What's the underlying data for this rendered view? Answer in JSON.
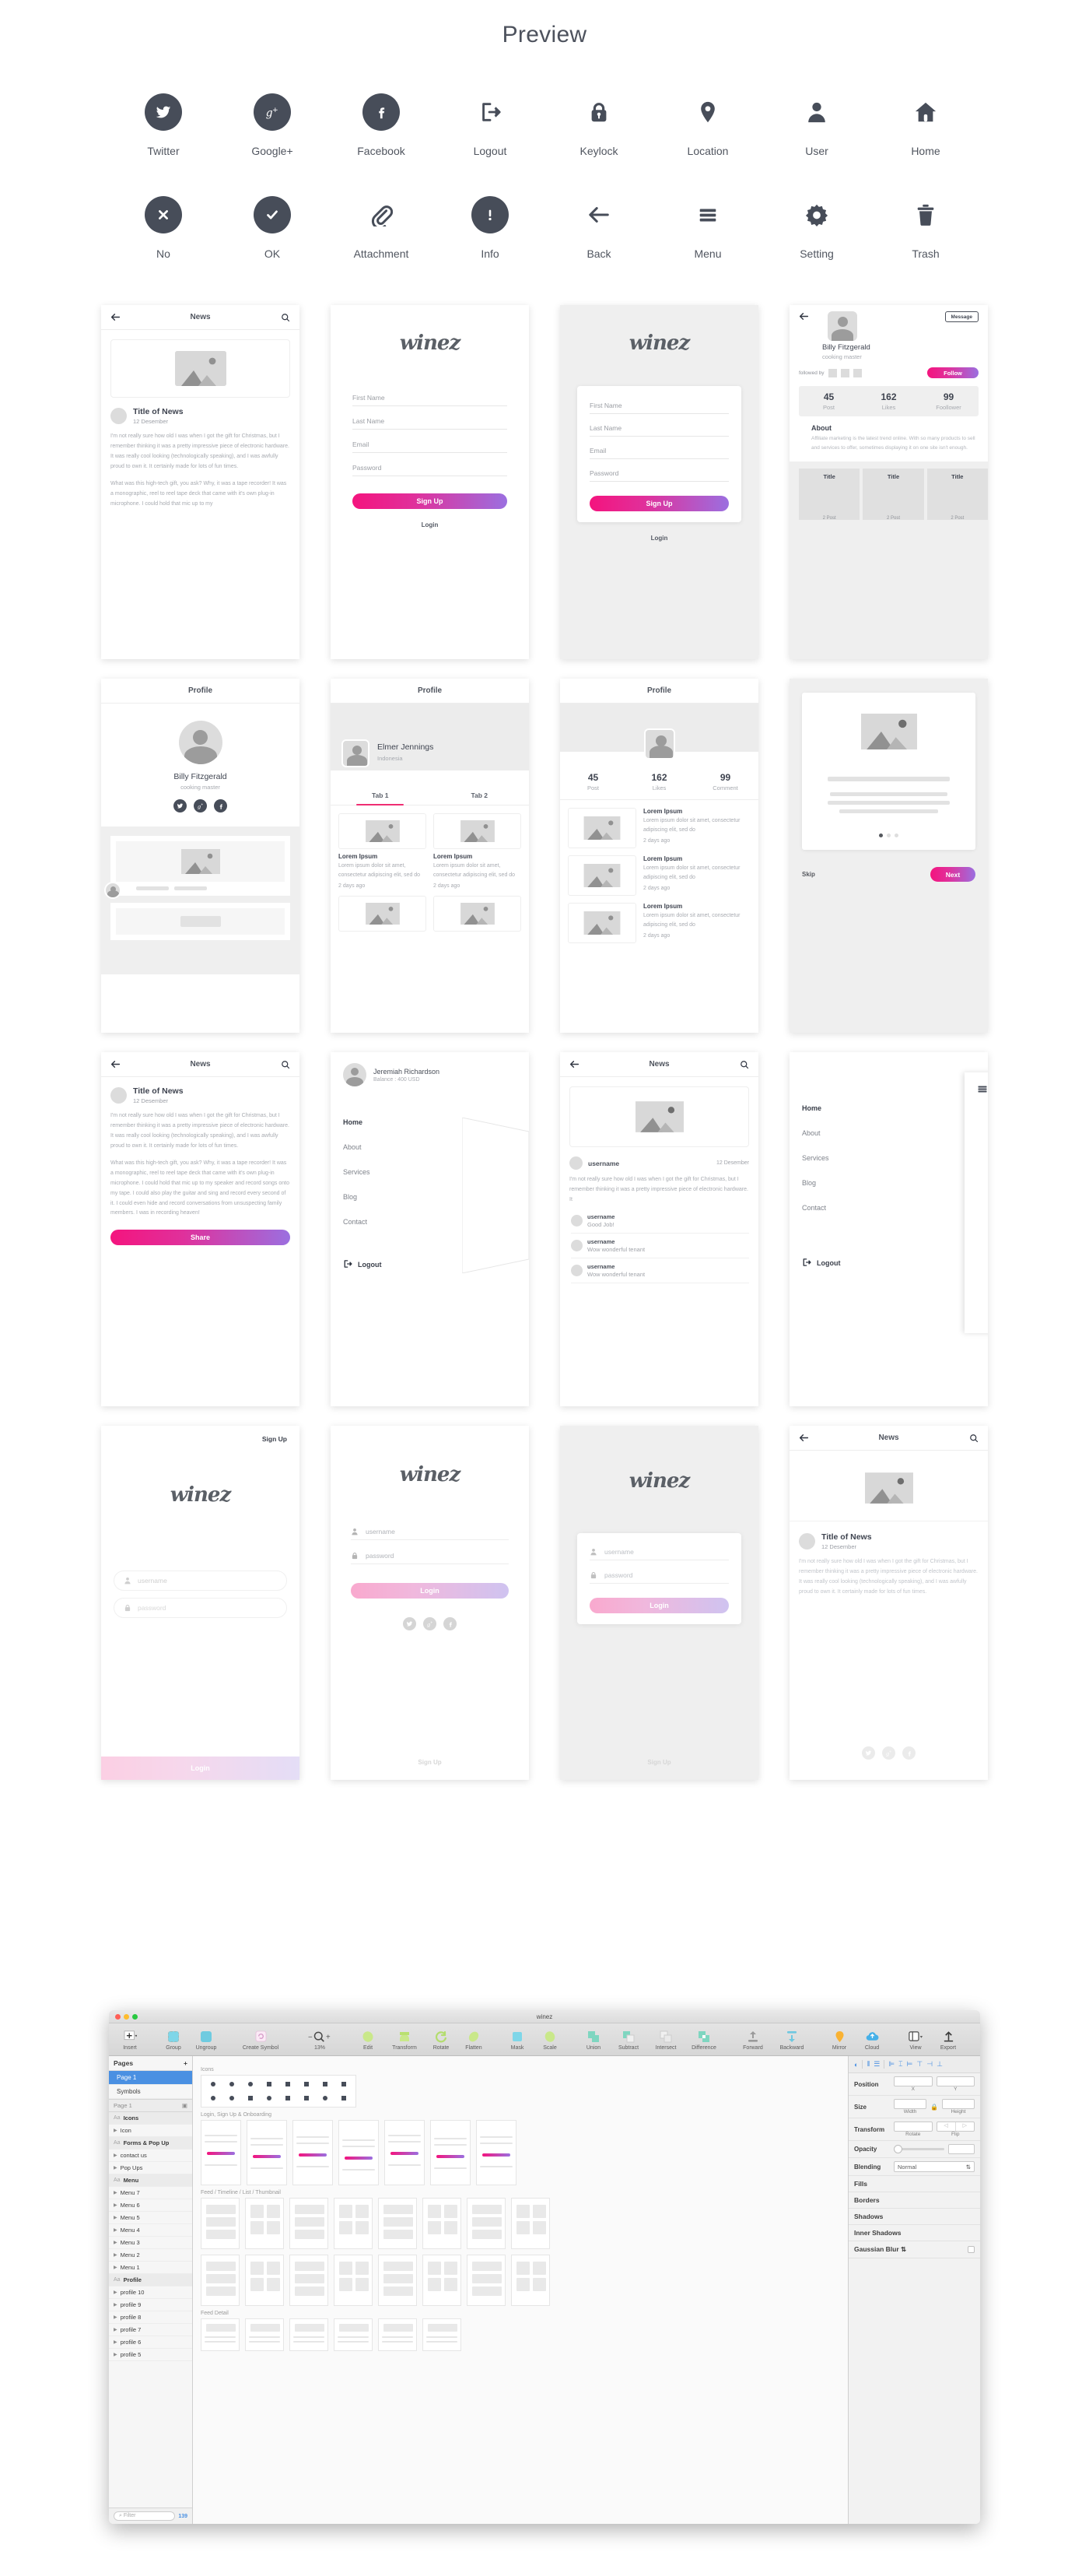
{
  "page": {
    "title": "Preview"
  },
  "icons": [
    {
      "label": "Twitter",
      "icon": "twitter-icon"
    },
    {
      "label": "Google+",
      "icon": "google-plus-icon"
    },
    {
      "label": "Facebook",
      "icon": "facebook-icon"
    },
    {
      "label": "Logout",
      "icon": "logout-icon"
    },
    {
      "label": "Keylock",
      "icon": "lock-icon"
    },
    {
      "label": "Location",
      "icon": "location-pin-icon"
    },
    {
      "label": "User",
      "icon": "user-icon"
    },
    {
      "label": "Home",
      "icon": "home-icon"
    },
    {
      "label": "No",
      "icon": "close-x-icon"
    },
    {
      "label": "OK",
      "icon": "check-icon"
    },
    {
      "label": "Attachment",
      "icon": "paperclip-icon"
    },
    {
      "label": "Info",
      "icon": "info-icon"
    },
    {
      "label": "Back",
      "icon": "arrow-left-icon"
    },
    {
      "label": "Menu",
      "icon": "hamburger-icon"
    },
    {
      "label": "Setting",
      "icon": "gear-icon"
    },
    {
      "label": "Trash",
      "icon": "trash-icon"
    }
  ],
  "brand": {
    "logo": "winez",
    "accent_from": "#f4147e",
    "accent_to": "#9b6fe0",
    "tab_accent": "#ef2d72"
  },
  "screens": {
    "news": {
      "topbar_title": "News",
      "title": "Title of News",
      "date": "12 Desember",
      "para1": "I'm not really sure how old I was when I got the gift for Christmas, but I remember thinking it was a pretty impressive piece of electronic hardware. It was really cool looking (technologically speaking), and I was awfully proud to own it. It certainly made for lots of fun times.",
      "para2": "What was this high-tech gift, you ask? Why, it was a tape recorder! It was a monographic, reel to reel tape deck that came with it's own plug-in microphone. I could hold that mic up to my",
      "para3": "What was this high-tech gift, you ask? Why, it was a tape recorder! It was a monographic, reel to reel tape deck that came with it's own plug-in microphone. I could hold that mic up to my speaker and record songs onto my tape. I could also play the guitar and sing and record every second of it. I could even hide and record conversations from unsuspecting family members. I was in recording heaven!",
      "share_button": "Share"
    },
    "signup": {
      "fields": [
        "First Name",
        "Last Name",
        "Email",
        "Password"
      ],
      "button": "Sign Up",
      "link": "Login"
    },
    "profile_card": {
      "message_button": "Message",
      "name": "Billy Fitzgerald",
      "role": "cooking master",
      "followed_by": "followed by",
      "follow_button": "Follow",
      "stats": [
        {
          "value": "45",
          "label": "Post"
        },
        {
          "value": "162",
          "label": "Likes"
        },
        {
          "value": "99",
          "label": "Foollower"
        }
      ],
      "about_heading": "About",
      "about_body": "Affiliate marketing is the latest trend online. With so many products to sell and services to offer, sometimes displaying it on one site isn't enough.",
      "cards": [
        {
          "title": "Title",
          "sub": "2 Post"
        },
        {
          "title": "Title",
          "sub": "2 Post"
        },
        {
          "title": "Title",
          "sub": "2 Post"
        }
      ]
    },
    "profile_social": {
      "topbar_title": "Profile",
      "name": "Billy Fitzgerald",
      "role": "cooking master",
      "socials": [
        "twitter-icon",
        "google-plus-icon",
        "facebook-icon"
      ]
    },
    "profile_tabs": {
      "topbar_title": "Profile",
      "name": "Elmer Jennings",
      "location": "Indonesia",
      "tabs": [
        "Tab 1",
        "Tab 2"
      ],
      "active_tab": 0,
      "items": [
        {
          "title": "Lorem Ipsum",
          "body": "Lorem ipsum dolor sit amet, consectetur adipiscing elit, sed do",
          "date": "2 days ago"
        },
        {
          "title": "Lorem Ipsum",
          "body": "Lorem ipsum dolor sit amet, consectetur adipiscing elit, sed do",
          "date": "2 days ago"
        }
      ]
    },
    "profile_stats": {
      "topbar_title": "Profile",
      "stats": [
        {
          "value": "45",
          "label": "Post"
        },
        {
          "value": "162",
          "label": "Likes"
        },
        {
          "value": "99",
          "label": "Comment"
        }
      ],
      "items": [
        {
          "title": "Lorem Ipsum",
          "body": "Lorem ipsum dolor sit amet, consectetur adipiscing elit, sed do",
          "date": "2 days ago"
        },
        {
          "title": "Lorem Ipsum",
          "body": "Lorem ipsum dolor sit amet, consectetur adipiscing elit, sed do",
          "date": "2 days ago"
        },
        {
          "title": "Lorem Ipsum",
          "body": "Lorem ipsum dolor sit amet, consectetur adipiscing elit, sed do",
          "date": "2 days ago"
        }
      ]
    },
    "onboarding": {
      "skip": "Skip",
      "next": "Next",
      "dots": 3,
      "active_dot": 0
    },
    "drawer": {
      "name": "Jeremiah Richardson",
      "balance": "Balance : 400 USD",
      "items": [
        "Home",
        "About",
        "Services",
        "Blog",
        "Contact"
      ],
      "active": "Home",
      "logout": "Logout"
    },
    "comments": {
      "topbar_title": "News",
      "author": "username",
      "date": "12 Desember",
      "post": "I'm not really sure how old I was when I got the gift for Christmas, but I remember thinking it was a pretty impressive piece of electronic hardware. It",
      "list": [
        {
          "user": "username",
          "text": "Good Job!"
        },
        {
          "user": "username",
          "text": "Wow wonderful tenant"
        },
        {
          "user": "username",
          "text": "Wow wonderful tenant"
        }
      ]
    },
    "menu_overlay": {
      "items": [
        "Home",
        "About",
        "Services",
        "Blog",
        "Contact"
      ],
      "active": "Home",
      "logout": "Logout"
    },
    "login_plain": {
      "signup_link": "Sign Up",
      "username": "username",
      "password": "password",
      "button": "Login"
    },
    "login_social": {
      "username": "username",
      "password": "password",
      "button": "Login",
      "signup_link": "Sign Up",
      "socials": [
        "twitter-icon",
        "google-plus-icon",
        "facebook-icon"
      ]
    },
    "login_card": {
      "username": "username",
      "password": "password",
      "button": "Login",
      "signup_link": "Sign Up"
    }
  },
  "sketch": {
    "document_title": "winez",
    "toolbar": [
      {
        "label": "Insert",
        "icon": "plus-icon"
      },
      {
        "label": "Group",
        "icon": "group-icon"
      },
      {
        "label": "Ungroup",
        "icon": "ungroup-icon"
      },
      {
        "label": "Create Symbol",
        "icon": "symbol-icon"
      },
      {
        "label": "13%",
        "icon": "zoom-icon"
      },
      {
        "label": "Edit",
        "icon": "edit-icon"
      },
      {
        "label": "Transform",
        "icon": "transform-icon"
      },
      {
        "label": "Rotate",
        "icon": "rotate-icon"
      },
      {
        "label": "Flatten",
        "icon": "flatten-icon"
      },
      {
        "label": "Mask",
        "icon": "mask-icon"
      },
      {
        "label": "Scale",
        "icon": "scale-icon"
      },
      {
        "label": "Union",
        "icon": "union-icon"
      },
      {
        "label": "Subtract",
        "icon": "subtract-icon"
      },
      {
        "label": "Intersect",
        "icon": "intersect-icon"
      },
      {
        "label": "Difference",
        "icon": "difference-icon"
      },
      {
        "label": "Forward",
        "icon": "forward-icon"
      },
      {
        "label": "Backward",
        "icon": "backward-icon"
      },
      {
        "label": "Mirror",
        "icon": "mirror-icon"
      },
      {
        "label": "Cloud",
        "icon": "cloud-icon"
      },
      {
        "label": "View",
        "icon": "view-icon"
      },
      {
        "label": "Export",
        "icon": "export-icon"
      }
    ],
    "pages_header": "Pages",
    "pages": [
      "Page 1",
      "Symbols"
    ],
    "selected_page": "Page 1",
    "layers_header": "Page 1",
    "layers": [
      {
        "name": "Icons",
        "type": "text"
      },
      {
        "name": "Icon",
        "type": "group"
      },
      {
        "name": "Forms & Pop Up",
        "type": "text"
      },
      {
        "name": "contact us",
        "type": "group"
      },
      {
        "name": "Pop Ups",
        "type": "group"
      },
      {
        "name": "Menu",
        "type": "text"
      },
      {
        "name": "Menu 7",
        "type": "group"
      },
      {
        "name": "Menu 6",
        "type": "group"
      },
      {
        "name": "Menu 5",
        "type": "group"
      },
      {
        "name": "Menu 4",
        "type": "group"
      },
      {
        "name": "Menu 3",
        "type": "group"
      },
      {
        "name": "Menu 2",
        "type": "group"
      },
      {
        "name": "Menu 1",
        "type": "group"
      },
      {
        "name": "Profile",
        "type": "text"
      },
      {
        "name": "profile 10",
        "type": "group"
      },
      {
        "name": "profile 9",
        "type": "group"
      },
      {
        "name": "profile 8",
        "type": "group"
      },
      {
        "name": "profile 7",
        "type": "group"
      },
      {
        "name": "profile 6",
        "type": "group"
      },
      {
        "name": "profile 5",
        "type": "group"
      }
    ],
    "filter_placeholder": "Filter",
    "layer_count": "139",
    "canvas_labels": [
      "Icons",
      "Login, Sign Up & Onboarding",
      "Feed / Timeline / List / Thumbnail",
      "Feed Detail"
    ],
    "inspector": {
      "rows": [
        {
          "label": "Position",
          "sub": [
            "X",
            "Y"
          ]
        },
        {
          "label": "Size",
          "sub": [
            "Width",
            "Height"
          ]
        },
        {
          "label": "Transform",
          "sub": [
            "Rotate",
            "Flip"
          ]
        }
      ],
      "opacity_label": "Opacity",
      "blending_label": "Blending",
      "blending_value": "Normal",
      "sections": [
        "Fills",
        "Borders",
        "Shadows",
        "Inner Shadows",
        "Gaussian Blur"
      ]
    }
  }
}
